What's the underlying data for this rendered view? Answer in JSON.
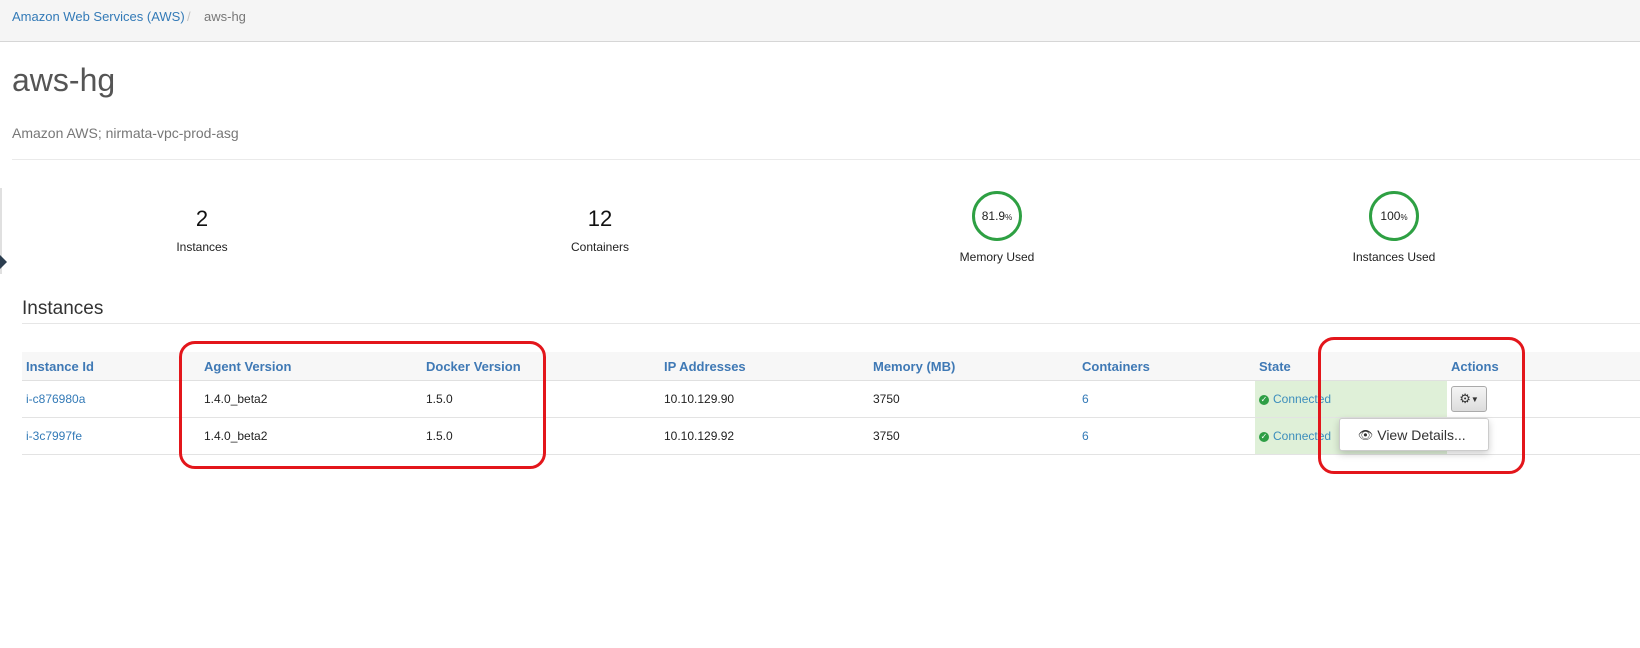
{
  "breadcrumb": {
    "root": "Amazon Web Services (AWS)",
    "separator": "/",
    "current": "aws-hg"
  },
  "page": {
    "title": "aws-hg",
    "subtitle": "Amazon AWS; nirmata-vpc-prod-asg"
  },
  "stats": [
    {
      "value": "2",
      "label": "Instances"
    },
    {
      "value": "12",
      "label": "Containers"
    }
  ],
  "gauges": [
    {
      "value": "81.9",
      "unit": "%",
      "label": "Memory Used",
      "percent": 81.9
    },
    {
      "value": "100",
      "unit": "%",
      "label": "Instances Used",
      "percent": 100
    }
  ],
  "instances": {
    "title": "Instances",
    "columns": [
      "Instance Id",
      "Agent Version",
      "Docker Version",
      "IP Addresses",
      "Memory (MB)",
      "Containers",
      "State",
      "Actions"
    ],
    "rows": [
      {
        "id": "i-c876980a",
        "agent": "1.4.0_beta2",
        "docker": "1.5.0",
        "ip": "10.10.129.90",
        "memory": "3750",
        "containers": "6",
        "state": "Connected"
      },
      {
        "id": "i-3c7997fe",
        "agent": "1.4.0_beta2",
        "docker": "1.5.0",
        "ip": "10.10.129.92",
        "memory": "3750",
        "containers": "6",
        "state": "Connected"
      }
    ]
  },
  "actions_menu": {
    "view_details": "View Details..."
  },
  "colors": {
    "link": "#337ab7",
    "gauge": "#2ea043",
    "state_bg": "#dff0d8",
    "highlight": "#e3161b"
  },
  "icons": {
    "gear": "gear-icon",
    "caret": "caret-down-icon",
    "check": "check-circle-icon",
    "eye": "eye-icon"
  }
}
